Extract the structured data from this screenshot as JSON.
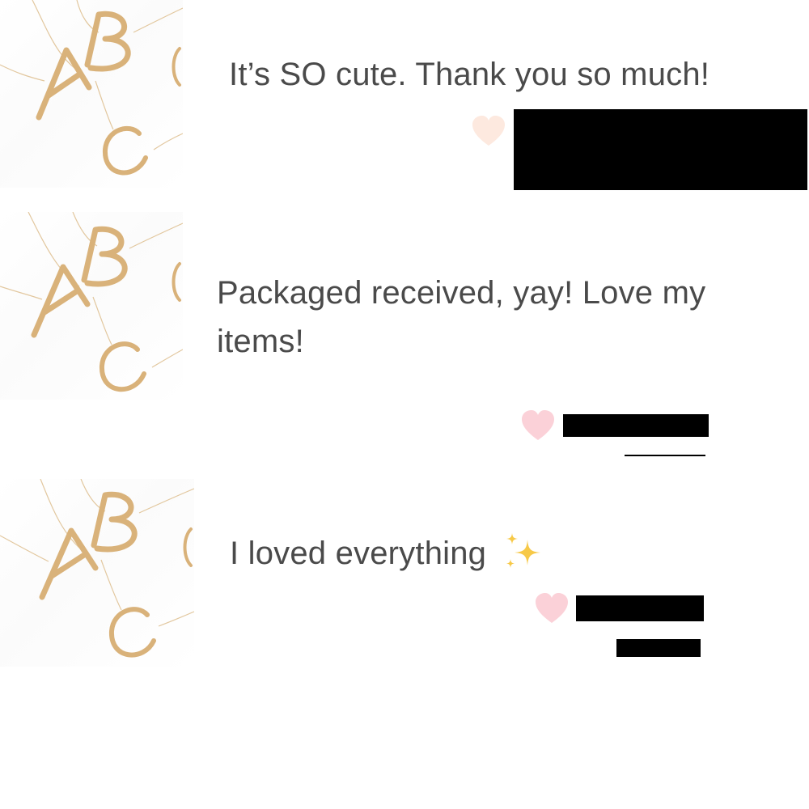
{
  "reviews": [
    {
      "text": "It’s SO cute. Thank you so much!",
      "reaction_icon": "heart-icon",
      "heart_color": "#fde9df",
      "reviewer_name_redacted": true
    },
    {
      "text": "Packaged received, yay! Love my items!",
      "reaction_icon": "heart-icon",
      "heart_color": "#fbd1d8",
      "reviewer_name_redacted": true
    },
    {
      "text": "I loved everything",
      "trailing_emoji": "sparkles-icon",
      "reaction_icon": "heart-icon",
      "heart_color": "#fbd1d8",
      "reviewer_name_redacted": true
    }
  ],
  "product_thumbnail": {
    "depicts": "gold letter necklaces",
    "letters": [
      "A",
      "B",
      "C"
    ],
    "metal_color": "#d9b27a"
  }
}
